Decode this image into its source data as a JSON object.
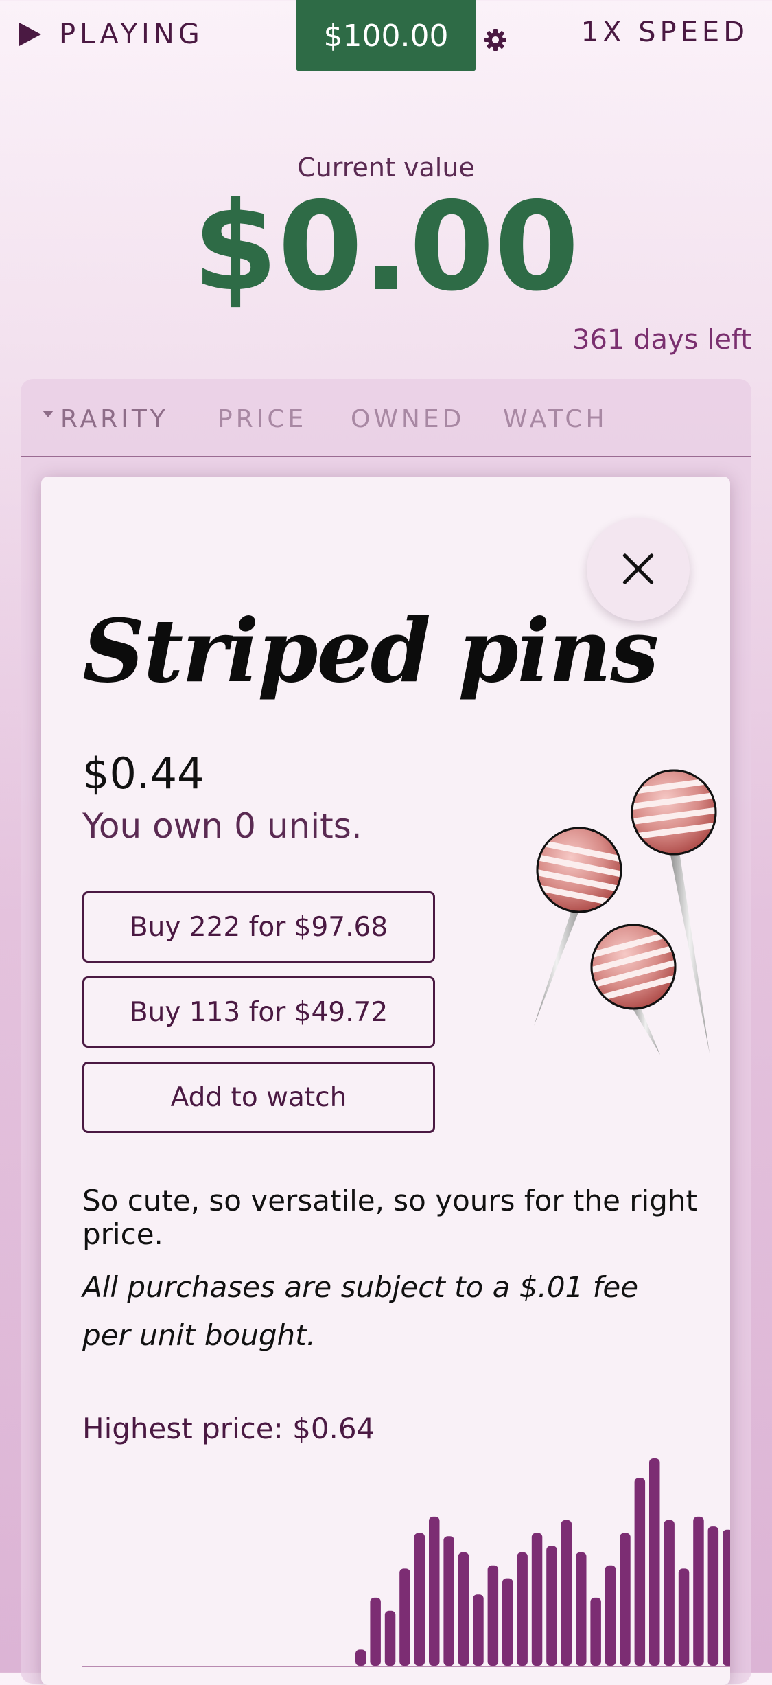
{
  "top_bar": {
    "play_label": "PLAYING",
    "money": "$100.00",
    "speed_label": "1X SPEED"
  },
  "summary": {
    "current_value_label": "Current value",
    "current_value": "$0.00",
    "days_left": "361 days left"
  },
  "table_tabs": [
    "RARITY",
    "PRICE",
    "OWNED",
    "WATCH"
  ],
  "modal": {
    "title": "Striped pins",
    "price": "$0.44",
    "owned_text": "You own 0 units.",
    "buttons": {
      "buy_max": "Buy 222 for $97.68",
      "buy_half": "Buy 113 for $49.72",
      "watch": "Add to watch"
    },
    "description": "So cute, so versatile, so yours for the right price.",
    "fee_note": "All purchases are subject to a $.01 fee per unit bought.",
    "highest_price": "Highest price: $0.64"
  },
  "colors": {
    "accent": "#4a1942",
    "money_green": "#2e6b46",
    "bar_purple": "#7c2d73"
  },
  "chart_data": {
    "type": "bar",
    "title": "",
    "xlabel": "",
    "ylabel": "",
    "ylim": [
      0,
      0.64
    ],
    "values": [
      0.05,
      0.21,
      0.17,
      0.3,
      0.41,
      0.46,
      0.4,
      0.35,
      0.22,
      0.31,
      0.27,
      0.35,
      0.41,
      0.37,
      0.45,
      0.35,
      0.21,
      0.31,
      0.41,
      0.58,
      0.64,
      0.45,
      0.3,
      0.46,
      0.43,
      0.42
    ]
  }
}
